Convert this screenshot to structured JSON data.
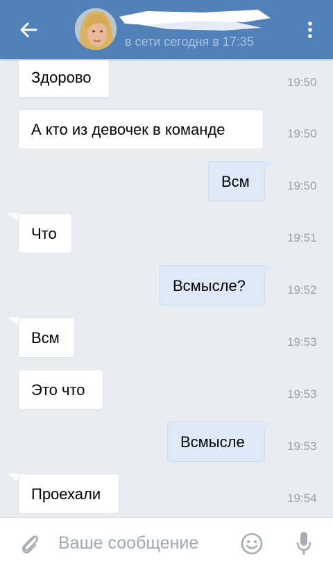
{
  "header": {
    "status": "в сети сегодня в 17:35",
    "colors": {
      "bar": "#5181b8",
      "status": "#a9c1de"
    }
  },
  "messages": [
    {
      "text": "Здорово",
      "time": "19:50",
      "direction": "in"
    },
    {
      "text": "А кто из девочек в команде",
      "time": "19:50",
      "direction": "in"
    },
    {
      "text": "Всм",
      "time": "19:50",
      "direction": "out"
    },
    {
      "text": "Что",
      "time": "19:51",
      "direction": "in"
    },
    {
      "text": "Всмысле?",
      "time": "19:52",
      "direction": "out"
    },
    {
      "text": "Всм",
      "time": "19:53",
      "direction": "in"
    },
    {
      "text": "Это что",
      "time": "19:53",
      "direction": "in"
    },
    {
      "text": "Всмысле",
      "time": "19:53",
      "direction": "out"
    },
    {
      "text": "Проехали",
      "time": "19:54",
      "direction": "in"
    }
  ],
  "composer": {
    "placeholder": "Ваше сообщение",
    "icons": [
      "paperclip-icon",
      "smile-icon",
      "microphone-icon"
    ]
  },
  "colors": {
    "background": "#e9edf2",
    "bubble_in": "#ffffff",
    "bubble_out": "#dde9f7",
    "time": "#9aa0a6"
  }
}
